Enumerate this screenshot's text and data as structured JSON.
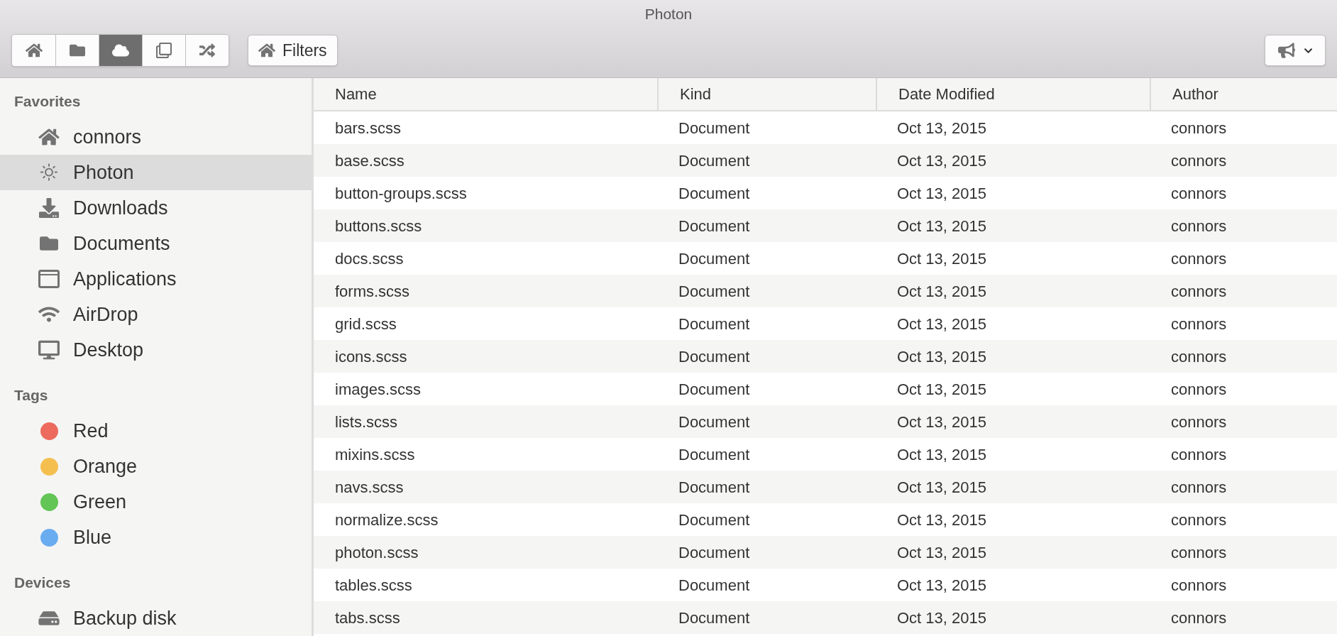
{
  "window": {
    "title": "Photon"
  },
  "toolbar": {
    "segments": [
      {
        "selected": false
      },
      {
        "selected": false
      },
      {
        "selected": true
      },
      {
        "selected": false
      },
      {
        "selected": false
      }
    ],
    "filters_button": "Filters"
  },
  "sidebar": {
    "sections": [
      {
        "title": "Favorites",
        "items": [
          {
            "label": "connors",
            "selected": false
          },
          {
            "label": "Photon",
            "selected": true
          },
          {
            "label": "Downloads",
            "selected": false
          },
          {
            "label": "Documents",
            "selected": false
          },
          {
            "label": "Applications",
            "selected": false
          },
          {
            "label": "AirDrop",
            "selected": false
          },
          {
            "label": "Desktop",
            "selected": false
          }
        ]
      },
      {
        "title": "Tags",
        "items": [
          {
            "label": "Red",
            "color": "#ec6a5e"
          },
          {
            "label": "Orange",
            "color": "#f5bf4f"
          },
          {
            "label": "Green",
            "color": "#62c555"
          },
          {
            "label": "Blue",
            "color": "#6aacf0"
          }
        ]
      },
      {
        "title": "Devices",
        "items": [
          {
            "label": "Backup disk",
            "selected": false
          }
        ]
      }
    ]
  },
  "table": {
    "columns": [
      "Name",
      "Kind",
      "Date Modified",
      "Author"
    ],
    "rows": [
      [
        "bars.scss",
        "Document",
        "Oct 13, 2015",
        "connors"
      ],
      [
        "base.scss",
        "Document",
        "Oct 13, 2015",
        "connors"
      ],
      [
        "button-groups.scss",
        "Document",
        "Oct 13, 2015",
        "connors"
      ],
      [
        "buttons.scss",
        "Document",
        "Oct 13, 2015",
        "connors"
      ],
      [
        "docs.scss",
        "Document",
        "Oct 13, 2015",
        "connors"
      ],
      [
        "forms.scss",
        "Document",
        "Oct 13, 2015",
        "connors"
      ],
      [
        "grid.scss",
        "Document",
        "Oct 13, 2015",
        "connors"
      ],
      [
        "icons.scss",
        "Document",
        "Oct 13, 2015",
        "connors"
      ],
      [
        "images.scss",
        "Document",
        "Oct 13, 2015",
        "connors"
      ],
      [
        "lists.scss",
        "Document",
        "Oct 13, 2015",
        "connors"
      ],
      [
        "mixins.scss",
        "Document",
        "Oct 13, 2015",
        "connors"
      ],
      [
        "navs.scss",
        "Document",
        "Oct 13, 2015",
        "connors"
      ],
      [
        "normalize.scss",
        "Document",
        "Oct 13, 2015",
        "connors"
      ],
      [
        "photon.scss",
        "Document",
        "Oct 13, 2015",
        "connors"
      ],
      [
        "tables.scss",
        "Document",
        "Oct 13, 2015",
        "connors"
      ],
      [
        "tabs.scss",
        "Document",
        "Oct 13, 2015",
        "connors"
      ]
    ]
  }
}
